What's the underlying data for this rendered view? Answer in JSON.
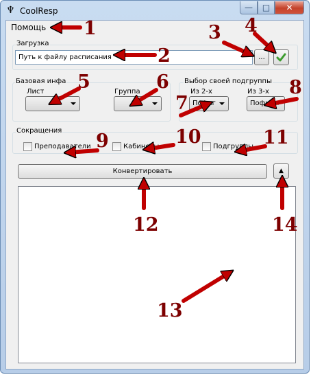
{
  "window": {
    "title": "CoolResp",
    "controls": {
      "minimize": "—",
      "maximize": "□",
      "close": "✕"
    }
  },
  "menu": {
    "help": "Помощь"
  },
  "load_group": {
    "label": "Загрузка",
    "path_value": "Путь к файлу расписания",
    "browse_label": "...",
    "confirm_icon": "check-icon"
  },
  "base_group": {
    "label": "Базовая инфа",
    "sheet_label": "Лист",
    "sheet_value": "",
    "group_label": "Группа",
    "group_value": ""
  },
  "subgroup_group": {
    "label": "Выбор своей подгруппы",
    "of2_label": "Из 2-х",
    "of2_value": "Пофиг",
    "of3_label": "Из 3-х",
    "of3_value": "Пофиг"
  },
  "abbrev_group": {
    "label": "Сокращения",
    "teachers": "Преподаватели",
    "rooms": "Кабинеты",
    "subgroups": "Подгруппы"
  },
  "convert_label": "Конвертировать",
  "collapse_label": "▲",
  "output_text": "",
  "annotations": [
    "1",
    "2",
    "3",
    "4",
    "5",
    "6",
    "7",
    "8",
    "9",
    "10",
    "11",
    "12",
    "13",
    "14"
  ],
  "colors": {
    "arrow": "#c00000",
    "arrow_outline": "#000000",
    "number": "#7d0000",
    "check_accent": "#3c9c2e"
  }
}
